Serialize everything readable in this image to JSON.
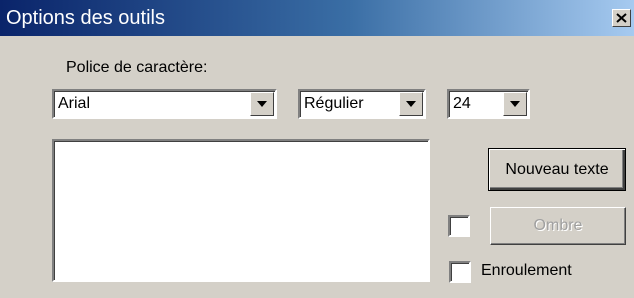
{
  "window": {
    "title": "Options des outils",
    "close_icon": "close-icon"
  },
  "font": {
    "label": "Police de caractère:",
    "family_value": "Arial",
    "style_value": "Régulier",
    "size_value": "24"
  },
  "text_area": {
    "value": ""
  },
  "buttons": {
    "new_text": "Nouveau texte",
    "shadow": "Ombre"
  },
  "checkboxes": {
    "shadow_checked": false,
    "wrap_label": "Enroulement",
    "wrap_checked": false
  }
}
